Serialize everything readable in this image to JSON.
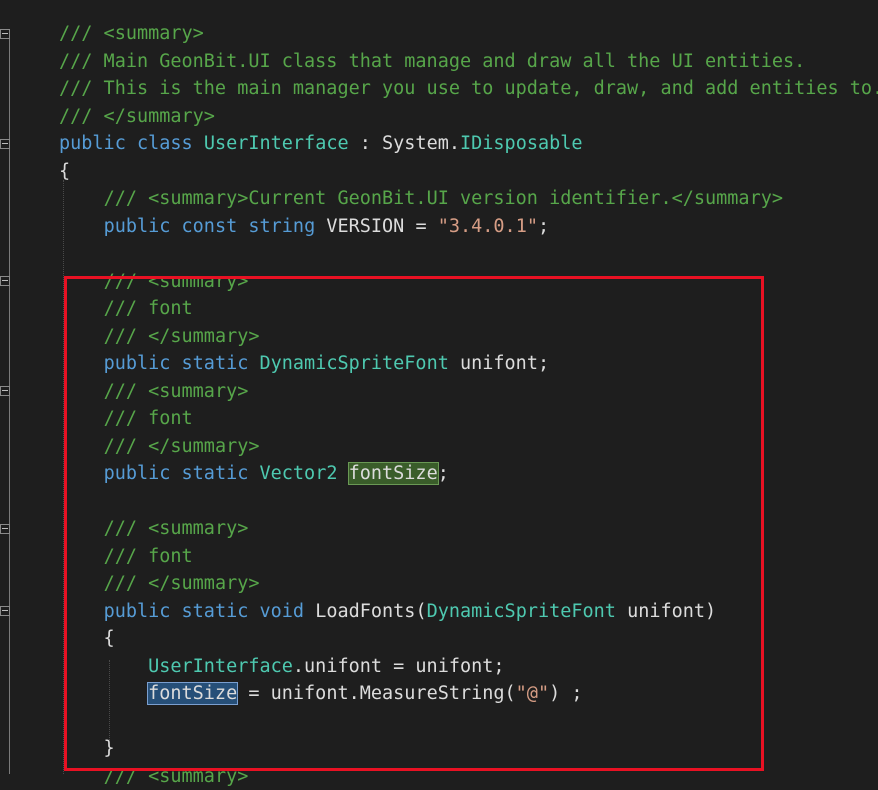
{
  "code_lines": [
    {
      "segments": [
        {
          "cls": "c",
          "text": "/// <summary>"
        }
      ]
    },
    {
      "segments": [
        {
          "cls": "c",
          "text": "/// Main GeonBit.UI class that manage and draw all the UI entities."
        }
      ]
    },
    {
      "segments": [
        {
          "cls": "c",
          "text": "/// This is the main manager you use to update, draw, and add entities to."
        }
      ]
    },
    {
      "segments": [
        {
          "cls": "c",
          "text": "/// </summary>"
        }
      ]
    },
    {
      "segments": [
        {
          "cls": "k",
          "text": "public"
        },
        {
          "cls": "p",
          "text": " "
        },
        {
          "cls": "k",
          "text": "class"
        },
        {
          "cls": "p",
          "text": " "
        },
        {
          "cls": "t",
          "text": "UserInterface"
        },
        {
          "cls": "p",
          "text": " : System."
        },
        {
          "cls": "t",
          "text": "IDisposable"
        }
      ]
    },
    {
      "segments": [
        {
          "cls": "p",
          "text": "{"
        }
      ]
    },
    {
      "segments": [
        {
          "cls": "p",
          "text": "    "
        },
        {
          "cls": "c",
          "text": "/// <summary>Current GeonBit.UI version identifier.</summary>"
        }
      ]
    },
    {
      "segments": [
        {
          "cls": "p",
          "text": "    "
        },
        {
          "cls": "k",
          "text": "public"
        },
        {
          "cls": "p",
          "text": " "
        },
        {
          "cls": "k",
          "text": "const"
        },
        {
          "cls": "p",
          "text": " "
        },
        {
          "cls": "k",
          "text": "string"
        },
        {
          "cls": "p",
          "text": " VERSION = "
        },
        {
          "cls": "s",
          "text": "\"3.4.0.1\""
        },
        {
          "cls": "p",
          "text": ";"
        }
      ]
    },
    {
      "segments": []
    },
    {
      "segments": [
        {
          "cls": "p",
          "text": "    "
        },
        {
          "cls": "c",
          "text": "/// <summary>"
        }
      ]
    },
    {
      "segments": [
        {
          "cls": "p",
          "text": "    "
        },
        {
          "cls": "c",
          "text": "/// font"
        }
      ]
    },
    {
      "segments": [
        {
          "cls": "p",
          "text": "    "
        },
        {
          "cls": "c",
          "text": "/// </summary>"
        }
      ]
    },
    {
      "segments": [
        {
          "cls": "p",
          "text": "    "
        },
        {
          "cls": "k",
          "text": "public"
        },
        {
          "cls": "p",
          "text": " "
        },
        {
          "cls": "k",
          "text": "static"
        },
        {
          "cls": "p",
          "text": " "
        },
        {
          "cls": "t",
          "text": "DynamicSpriteFont"
        },
        {
          "cls": "p",
          "text": " unifont;"
        }
      ]
    },
    {
      "segments": [
        {
          "cls": "p",
          "text": "    "
        },
        {
          "cls": "c",
          "text": "/// <summary>"
        }
      ]
    },
    {
      "segments": [
        {
          "cls": "p",
          "text": "    "
        },
        {
          "cls": "c",
          "text": "/// font"
        }
      ]
    },
    {
      "segments": [
        {
          "cls": "p",
          "text": "    "
        },
        {
          "cls": "c",
          "text": "/// </summary>"
        }
      ]
    },
    {
      "segments": [
        {
          "cls": "p",
          "text": "    "
        },
        {
          "cls": "k",
          "text": "public"
        },
        {
          "cls": "p",
          "text": " "
        },
        {
          "cls": "k",
          "text": "static"
        },
        {
          "cls": "p",
          "text": " "
        },
        {
          "cls": "t",
          "text": "Vector2"
        },
        {
          "cls": "p",
          "text": " "
        },
        {
          "cls": "p hl-green",
          "text": "fontSize"
        },
        {
          "cls": "p",
          "text": ";"
        }
      ]
    },
    {
      "segments": []
    },
    {
      "segments": [
        {
          "cls": "p",
          "text": "    "
        },
        {
          "cls": "c",
          "text": "/// <summary>"
        }
      ]
    },
    {
      "segments": [
        {
          "cls": "p",
          "text": "    "
        },
        {
          "cls": "c",
          "text": "/// font"
        }
      ]
    },
    {
      "segments": [
        {
          "cls": "p",
          "text": "    "
        },
        {
          "cls": "c",
          "text": "/// </summary>"
        }
      ]
    },
    {
      "segments": [
        {
          "cls": "p",
          "text": "    "
        },
        {
          "cls": "k",
          "text": "public"
        },
        {
          "cls": "p",
          "text": " "
        },
        {
          "cls": "k",
          "text": "static"
        },
        {
          "cls": "p",
          "text": " "
        },
        {
          "cls": "k",
          "text": "void"
        },
        {
          "cls": "p",
          "text": " LoadFonts("
        },
        {
          "cls": "t",
          "text": "DynamicSpriteFont"
        },
        {
          "cls": "p",
          "text": " unifont)"
        }
      ]
    },
    {
      "segments": [
        {
          "cls": "p",
          "text": "    {"
        }
      ]
    },
    {
      "segments": [
        {
          "cls": "p",
          "text": "        "
        },
        {
          "cls": "t",
          "text": "UserInterface"
        },
        {
          "cls": "p",
          "text": ".unifont = unifont;"
        }
      ]
    },
    {
      "segments": [
        {
          "cls": "p",
          "text": "        "
        },
        {
          "cls": "p hl-blue",
          "text": "fontSize"
        },
        {
          "cls": "p",
          "text": " = unifont.MeasureString("
        },
        {
          "cls": "s",
          "text": "\"@\""
        },
        {
          "cls": "p",
          "text": ") ;"
        }
      ]
    },
    {
      "segments": []
    },
    {
      "segments": [
        {
          "cls": "p",
          "text": "    }"
        }
      ]
    },
    {
      "segments": [
        {
          "cls": "p",
          "text": "    "
        },
        {
          "cls": "c",
          "text": "/// <summary>"
        }
      ]
    }
  ],
  "colors": {
    "background": "#1e1e1e",
    "comment": "#57a64a",
    "keyword": "#569cd6",
    "type": "#4ec9b0",
    "string": "#d69d85",
    "plain": "#dcdcdc",
    "highlight_box": "#e81123"
  }
}
